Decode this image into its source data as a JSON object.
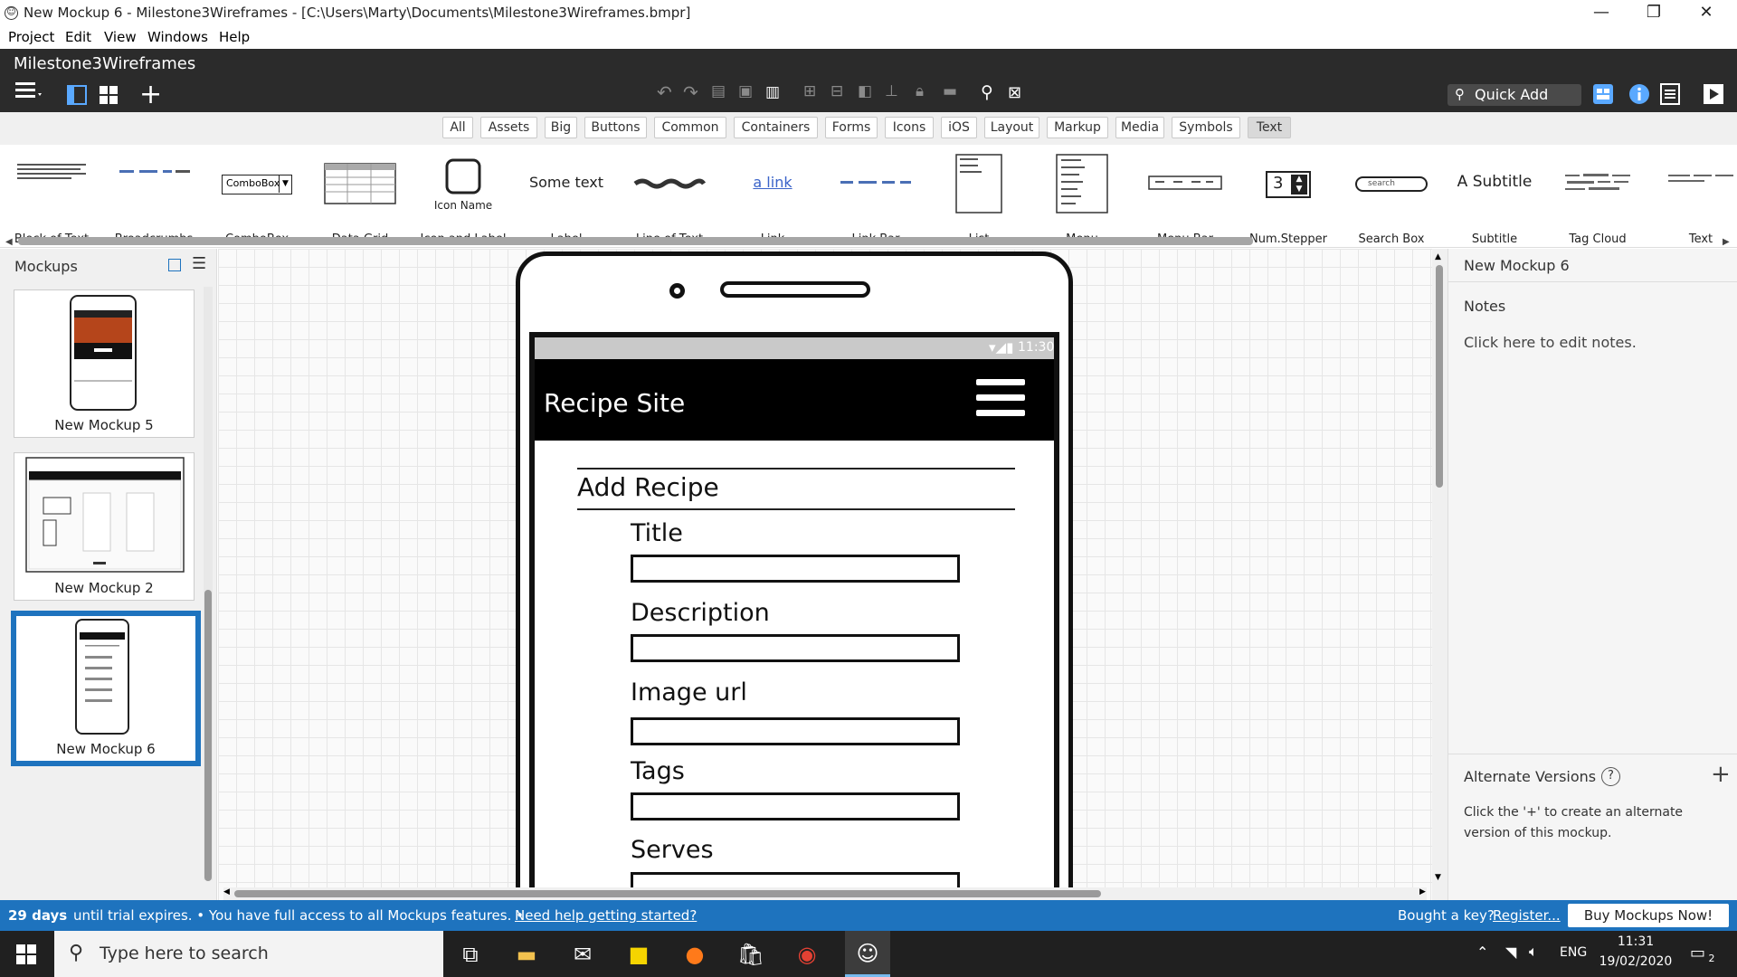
{
  "window": {
    "title": "New Mockup 6 - Milestone3Wireframes - [C:\\Users\\Marty\\Documents\\Milestone3Wireframes.bmpr]",
    "minimize": "—",
    "restore": "❐",
    "close": "✕"
  },
  "menu": [
    "Project",
    "Edit",
    "View",
    "Windows",
    "Help"
  ],
  "toolbar": {
    "project_name": "Milestone3Wireframes",
    "quick_add": "Quick Add"
  },
  "filters": {
    "tabs": [
      "All",
      "Assets",
      "Big",
      "Buttons",
      "Common",
      "Containers",
      "Forms",
      "Icons",
      "iOS",
      "Layout",
      "Markup",
      "Media",
      "Symbols",
      "Text"
    ],
    "selected": "Text"
  },
  "library": {
    "items": [
      "Block of Text",
      "Breadcrumbs",
      "ComboBox",
      "Data Grid",
      "Icon and Label",
      "Label",
      "Line of Text",
      "Link",
      "Link Bar",
      "List",
      "Menu",
      "Menu Bar",
      "Num.Stepper",
      "Search Box",
      "Subtitle",
      "Tag Cloud",
      "Text"
    ],
    "preview": {
      "combobox": "ComboBox",
      "icon_name": "Icon Name",
      "label": "Some text",
      "link": "a link",
      "stepper": "3",
      "search": "search",
      "subtitle": "A Subtitle"
    }
  },
  "mockups": {
    "header": "Mockups",
    "items": [
      {
        "name": "New Mockup 5",
        "selected": false
      },
      {
        "name": "New Mockup 2",
        "selected": false
      },
      {
        "name": "New Mockup 6",
        "selected": true
      }
    ]
  },
  "wireframe": {
    "time": "11:30",
    "site_title": "Recipe Site",
    "heading": "Add Recipe",
    "fields": [
      "Title",
      "Description",
      "Image url",
      "Tags",
      "Serves"
    ]
  },
  "properties": {
    "mockup_name": "New Mockup 6",
    "notes_label": "Notes",
    "notes_placeholder": "Click here to edit notes.",
    "alt_versions_label": "Alternate Versions",
    "help_glyph": "?",
    "alt_versions_hint": "Click the '+' to create an alternate version of this mockup."
  },
  "status": {
    "days": "29 days",
    "trial_text": "until trial expires.  •  You have full access to all Mockups features.  •",
    "help_link": "Need help getting started?",
    "key_text": "Bought a key?",
    "register_link": "Register...",
    "buy_button": "Buy Mockups Now!"
  },
  "taskbar": {
    "search_placeholder": "Type here to search",
    "lang": "ENG",
    "time": "11:31",
    "date": "19/02/2020",
    "notif_count": "2"
  }
}
